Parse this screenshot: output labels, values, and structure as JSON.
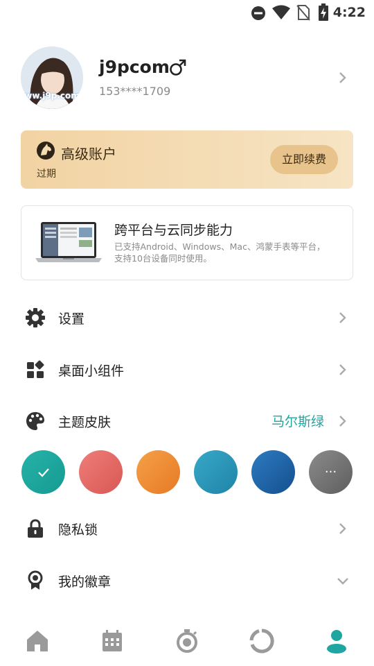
{
  "status_bar": {
    "time": "4:22",
    "icons": [
      "dnd-icon",
      "wifi-icon",
      "no-sim-icon",
      "battery-charging-icon"
    ]
  },
  "profile": {
    "avatar_watermark": "ww.j9p.com",
    "username": "j9pcom",
    "gender_icon": "male-icon",
    "phone": "153****1709"
  },
  "premium": {
    "title": "高级账户",
    "status": "过期",
    "renew_label": "立即续费",
    "colors": {
      "card_start": "#f2d3a3",
      "card_end": "#f6e4c4",
      "button": "#e8c48c"
    }
  },
  "sync": {
    "title": "跨平台与云同步能力",
    "desc_line1": "已支持Android、Windows、Mac、鸿蒙手表等平台，",
    "desc_line2": "支持10台设备同时使用。"
  },
  "menu": {
    "settings": "设置",
    "widgets": "桌面小组件",
    "theme": "主题皮肤",
    "theme_value": "马尔斯绿",
    "privacy": "隐私锁",
    "badges": "我的徽章"
  },
  "theme_swatches": [
    {
      "name": "teal",
      "from": "#26b3a9",
      "to": "#159a92",
      "selected": true
    },
    {
      "name": "red",
      "from": "#ee7e7a",
      "to": "#d95753",
      "selected": false
    },
    {
      "name": "orange",
      "from": "#f5a04a",
      "to": "#e67a22",
      "selected": false
    },
    {
      "name": "blue",
      "from": "#38a8c8",
      "to": "#1f84a8",
      "selected": false
    },
    {
      "name": "navy",
      "from": "#2c7cc0",
      "to": "#154f8f",
      "selected": false
    },
    {
      "name": "gray",
      "from": "#8b8b8b",
      "to": "#5e5e5e",
      "selected": false
    }
  ],
  "swatch_more_symbol": "···",
  "bottom_nav": {
    "items": [
      "home-icon",
      "calendar-icon",
      "timer-icon",
      "stats-icon",
      "profile-icon"
    ],
    "active": "profile-icon",
    "active_color": "#1fa6a0",
    "inactive_color": "#9a9a9a"
  }
}
